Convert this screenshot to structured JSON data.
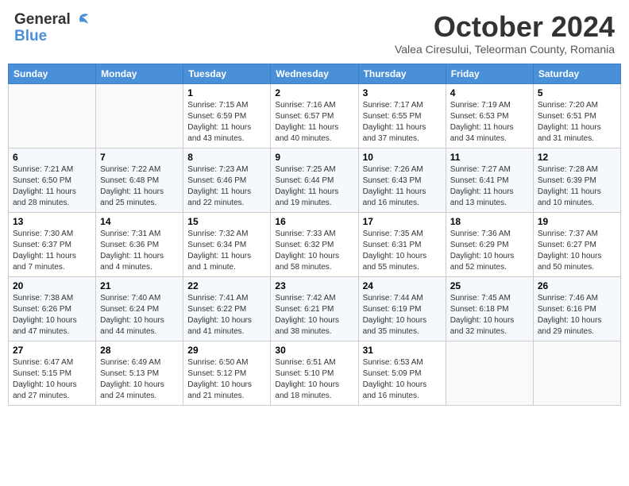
{
  "header": {
    "logo_general": "General",
    "logo_blue": "Blue",
    "month_title": "October 2024",
    "subtitle": "Valea Ciresului, Teleorman County, Romania"
  },
  "weekdays": [
    "Sunday",
    "Monday",
    "Tuesday",
    "Wednesday",
    "Thursday",
    "Friday",
    "Saturday"
  ],
  "weeks": [
    [
      {
        "day": "",
        "sunrise": "",
        "sunset": "",
        "daylight": ""
      },
      {
        "day": "",
        "sunrise": "",
        "sunset": "",
        "daylight": ""
      },
      {
        "day": "1",
        "sunrise": "Sunrise: 7:15 AM",
        "sunset": "Sunset: 6:59 PM",
        "daylight": "Daylight: 11 hours and 43 minutes."
      },
      {
        "day": "2",
        "sunrise": "Sunrise: 7:16 AM",
        "sunset": "Sunset: 6:57 PM",
        "daylight": "Daylight: 11 hours and 40 minutes."
      },
      {
        "day": "3",
        "sunrise": "Sunrise: 7:17 AM",
        "sunset": "Sunset: 6:55 PM",
        "daylight": "Daylight: 11 hours and 37 minutes."
      },
      {
        "day": "4",
        "sunrise": "Sunrise: 7:19 AM",
        "sunset": "Sunset: 6:53 PM",
        "daylight": "Daylight: 11 hours and 34 minutes."
      },
      {
        "day": "5",
        "sunrise": "Sunrise: 7:20 AM",
        "sunset": "Sunset: 6:51 PM",
        "daylight": "Daylight: 11 hours and 31 minutes."
      }
    ],
    [
      {
        "day": "6",
        "sunrise": "Sunrise: 7:21 AM",
        "sunset": "Sunset: 6:50 PM",
        "daylight": "Daylight: 11 hours and 28 minutes."
      },
      {
        "day": "7",
        "sunrise": "Sunrise: 7:22 AM",
        "sunset": "Sunset: 6:48 PM",
        "daylight": "Daylight: 11 hours and 25 minutes."
      },
      {
        "day": "8",
        "sunrise": "Sunrise: 7:23 AM",
        "sunset": "Sunset: 6:46 PM",
        "daylight": "Daylight: 11 hours and 22 minutes."
      },
      {
        "day": "9",
        "sunrise": "Sunrise: 7:25 AM",
        "sunset": "Sunset: 6:44 PM",
        "daylight": "Daylight: 11 hours and 19 minutes."
      },
      {
        "day": "10",
        "sunrise": "Sunrise: 7:26 AM",
        "sunset": "Sunset: 6:43 PM",
        "daylight": "Daylight: 11 hours and 16 minutes."
      },
      {
        "day": "11",
        "sunrise": "Sunrise: 7:27 AM",
        "sunset": "Sunset: 6:41 PM",
        "daylight": "Daylight: 11 hours and 13 minutes."
      },
      {
        "day": "12",
        "sunrise": "Sunrise: 7:28 AM",
        "sunset": "Sunset: 6:39 PM",
        "daylight": "Daylight: 11 hours and 10 minutes."
      }
    ],
    [
      {
        "day": "13",
        "sunrise": "Sunrise: 7:30 AM",
        "sunset": "Sunset: 6:37 PM",
        "daylight": "Daylight: 11 hours and 7 minutes."
      },
      {
        "day": "14",
        "sunrise": "Sunrise: 7:31 AM",
        "sunset": "Sunset: 6:36 PM",
        "daylight": "Daylight: 11 hours and 4 minutes."
      },
      {
        "day": "15",
        "sunrise": "Sunrise: 7:32 AM",
        "sunset": "Sunset: 6:34 PM",
        "daylight": "Daylight: 11 hours and 1 minute."
      },
      {
        "day": "16",
        "sunrise": "Sunrise: 7:33 AM",
        "sunset": "Sunset: 6:32 PM",
        "daylight": "Daylight: 10 hours and 58 minutes."
      },
      {
        "day": "17",
        "sunrise": "Sunrise: 7:35 AM",
        "sunset": "Sunset: 6:31 PM",
        "daylight": "Daylight: 10 hours and 55 minutes."
      },
      {
        "day": "18",
        "sunrise": "Sunrise: 7:36 AM",
        "sunset": "Sunset: 6:29 PM",
        "daylight": "Daylight: 10 hours and 52 minutes."
      },
      {
        "day": "19",
        "sunrise": "Sunrise: 7:37 AM",
        "sunset": "Sunset: 6:27 PM",
        "daylight": "Daylight: 10 hours and 50 minutes."
      }
    ],
    [
      {
        "day": "20",
        "sunrise": "Sunrise: 7:38 AM",
        "sunset": "Sunset: 6:26 PM",
        "daylight": "Daylight: 10 hours and 47 minutes."
      },
      {
        "day": "21",
        "sunrise": "Sunrise: 7:40 AM",
        "sunset": "Sunset: 6:24 PM",
        "daylight": "Daylight: 10 hours and 44 minutes."
      },
      {
        "day": "22",
        "sunrise": "Sunrise: 7:41 AM",
        "sunset": "Sunset: 6:22 PM",
        "daylight": "Daylight: 10 hours and 41 minutes."
      },
      {
        "day": "23",
        "sunrise": "Sunrise: 7:42 AM",
        "sunset": "Sunset: 6:21 PM",
        "daylight": "Daylight: 10 hours and 38 minutes."
      },
      {
        "day": "24",
        "sunrise": "Sunrise: 7:44 AM",
        "sunset": "Sunset: 6:19 PM",
        "daylight": "Daylight: 10 hours and 35 minutes."
      },
      {
        "day": "25",
        "sunrise": "Sunrise: 7:45 AM",
        "sunset": "Sunset: 6:18 PM",
        "daylight": "Daylight: 10 hours and 32 minutes."
      },
      {
        "day": "26",
        "sunrise": "Sunrise: 7:46 AM",
        "sunset": "Sunset: 6:16 PM",
        "daylight": "Daylight: 10 hours and 29 minutes."
      }
    ],
    [
      {
        "day": "27",
        "sunrise": "Sunrise: 6:47 AM",
        "sunset": "Sunset: 5:15 PM",
        "daylight": "Daylight: 10 hours and 27 minutes."
      },
      {
        "day": "28",
        "sunrise": "Sunrise: 6:49 AM",
        "sunset": "Sunset: 5:13 PM",
        "daylight": "Daylight: 10 hours and 24 minutes."
      },
      {
        "day": "29",
        "sunrise": "Sunrise: 6:50 AM",
        "sunset": "Sunset: 5:12 PM",
        "daylight": "Daylight: 10 hours and 21 minutes."
      },
      {
        "day": "30",
        "sunrise": "Sunrise: 6:51 AM",
        "sunset": "Sunset: 5:10 PM",
        "daylight": "Daylight: 10 hours and 18 minutes."
      },
      {
        "day": "31",
        "sunrise": "Sunrise: 6:53 AM",
        "sunset": "Sunset: 5:09 PM",
        "daylight": "Daylight: 10 hours and 16 minutes."
      },
      {
        "day": "",
        "sunrise": "",
        "sunset": "",
        "daylight": ""
      },
      {
        "day": "",
        "sunrise": "",
        "sunset": "",
        "daylight": ""
      }
    ]
  ]
}
